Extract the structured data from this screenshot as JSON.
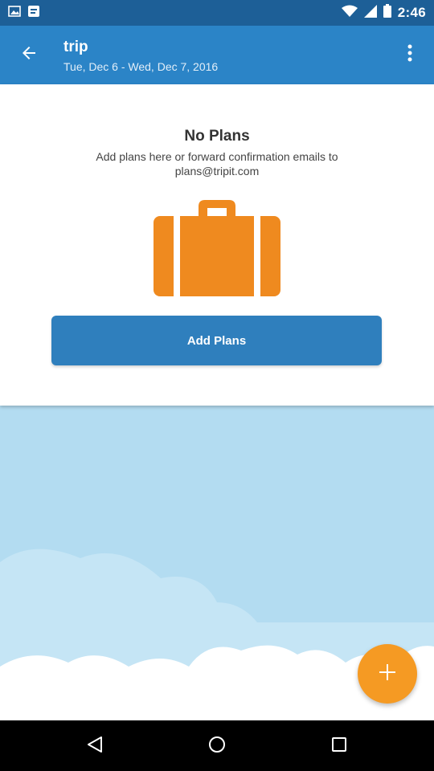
{
  "status_bar": {
    "time": "2:46",
    "icons": [
      "image-icon",
      "notification-icon",
      "wifi-icon",
      "signal-icon",
      "battery-icon"
    ]
  },
  "app_bar": {
    "title": "trip",
    "subtitle": "Tue, Dec 6 - Wed, Dec 7, 2016",
    "back_icon": "back-arrow-icon",
    "overflow_icon": "more-vertical-icon"
  },
  "empty_state": {
    "title": "No Plans",
    "description": "Add plans here or forward confirmation emails to plans@tripit.com",
    "image_icon": "suitcase-icon",
    "button_label": "Add Plans"
  },
  "fab": {
    "icon": "plus-icon"
  },
  "nav_bar": {
    "icons": [
      "back-icon",
      "home-icon",
      "recents-icon"
    ]
  },
  "colors": {
    "status_bar": "#1d5f97",
    "app_bar": "#2b84c7",
    "accent": "#f59a23",
    "suitcase": "#ef8a1f",
    "button": "#2f7fbd",
    "sky": "#b3dcf1"
  }
}
